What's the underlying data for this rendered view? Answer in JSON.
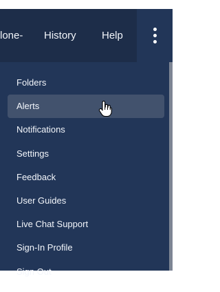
{
  "topbar": {
    "items": [
      {
        "label": "lone-"
      },
      {
        "label": "History"
      },
      {
        "label": "Help"
      }
    ],
    "menu_icon": "kebab-vertical-icon"
  },
  "menu": {
    "items": [
      {
        "label": "Folders"
      },
      {
        "label": "Alerts",
        "state": "hovered"
      },
      {
        "label": "Notifications"
      },
      {
        "label": "Settings"
      },
      {
        "label": "Feedback"
      },
      {
        "label": "User Guides"
      },
      {
        "label": "Live Chat Support"
      },
      {
        "label": "Sign-In Profile"
      },
      {
        "label": "Sign Out"
      }
    ]
  },
  "cursor": "hand-pointer-icon",
  "colors": {
    "header_bg": "#1d2d49",
    "menu_bg": "#223658",
    "hover_bg": "#42526d",
    "text": "#f3f6fb",
    "menu_border": "#7d8594"
  }
}
